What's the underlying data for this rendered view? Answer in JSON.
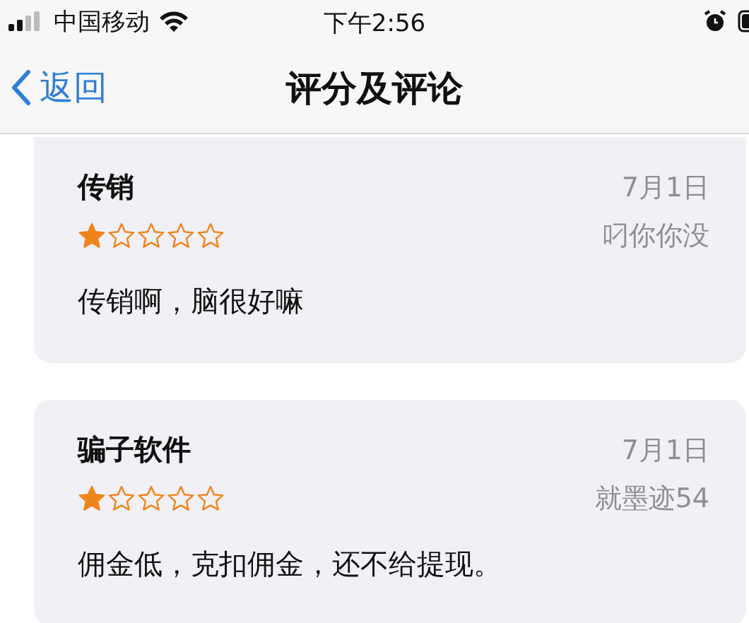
{
  "status_bar": {
    "carrier": "中国移动",
    "time": "下午2:56"
  },
  "nav": {
    "back": "返回",
    "title": "评分及评论"
  },
  "reviews": [
    {
      "title": "传销",
      "date": "7月1日",
      "author": "叼你你没",
      "stars": 1,
      "body": "传销啊，脑很好嘛"
    },
    {
      "title": "骗子软件",
      "date": "7月1日",
      "author": "就墨迹54",
      "stars": 1,
      "body": "佣金低，克扣佣金，还不给提现。"
    }
  ]
}
